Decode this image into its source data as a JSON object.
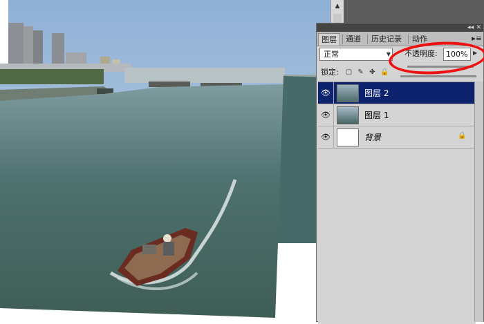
{
  "panel": {
    "tabs": [
      {
        "label": "图层",
        "active": true
      },
      {
        "label": "通道",
        "active": false
      },
      {
        "label": "历史记录",
        "active": false
      },
      {
        "label": "动作",
        "active": false
      }
    ],
    "menu_icon": "panel-menu-icon",
    "blend_mode": "正常",
    "opacity_label": "不透明度:",
    "opacity_value": "100%",
    "lock_label": "锁定:",
    "lock_icons": [
      "lock-transparency-icon",
      "lock-paint-icon",
      "lock-move-icon",
      "lock-all-icon"
    ],
    "layers": [
      {
        "name": "图层 2",
        "selected": true
      },
      {
        "name": "图层 1",
        "selected": false
      },
      {
        "name": "背景",
        "selected": false,
        "locked": true
      }
    ]
  },
  "colors": {
    "panel_bg": "#d4d4d4",
    "selected_layer": "#0d236e",
    "annotation": "#ee1111",
    "workspace": "#5c5c5c"
  }
}
